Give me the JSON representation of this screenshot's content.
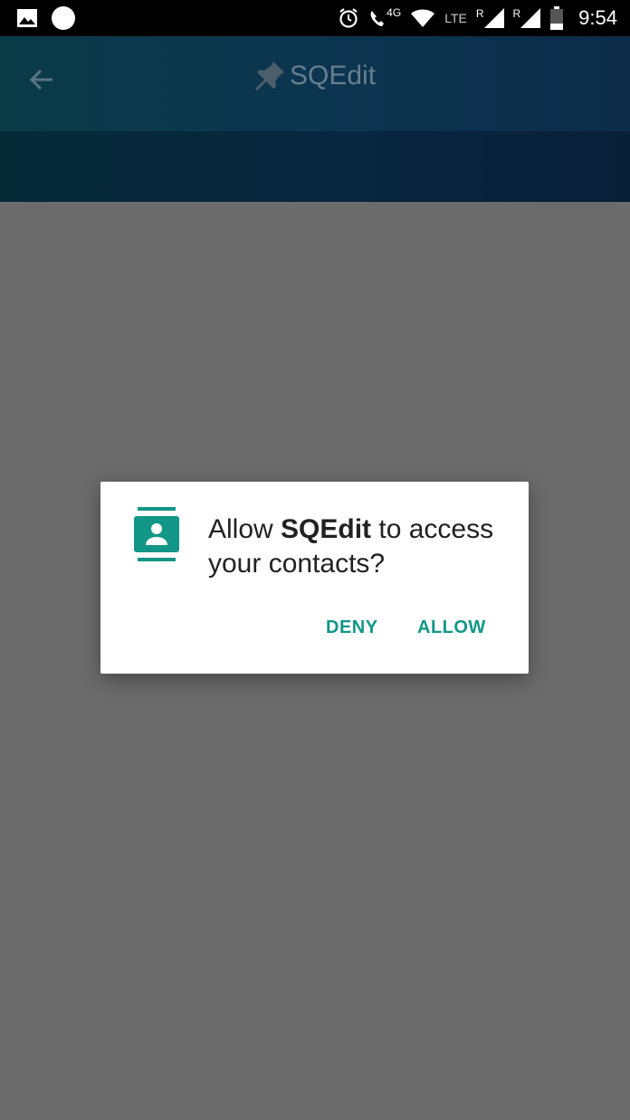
{
  "status_bar": {
    "time": "9:54",
    "network_4g": "4G",
    "network_lte": "LTE",
    "roaming_1": "R",
    "roaming_2": "R"
  },
  "app_bar": {
    "title": "SQEdit",
    "background_color": "#0c3550"
  },
  "dialog": {
    "message_prefix": "Allow ",
    "app_name": "SQEdit",
    "message_suffix": " to access your contacts?",
    "deny_label": "DENY",
    "allow_label": "ALLOW",
    "accent_color": "#129688",
    "icon": "contacts-icon"
  }
}
